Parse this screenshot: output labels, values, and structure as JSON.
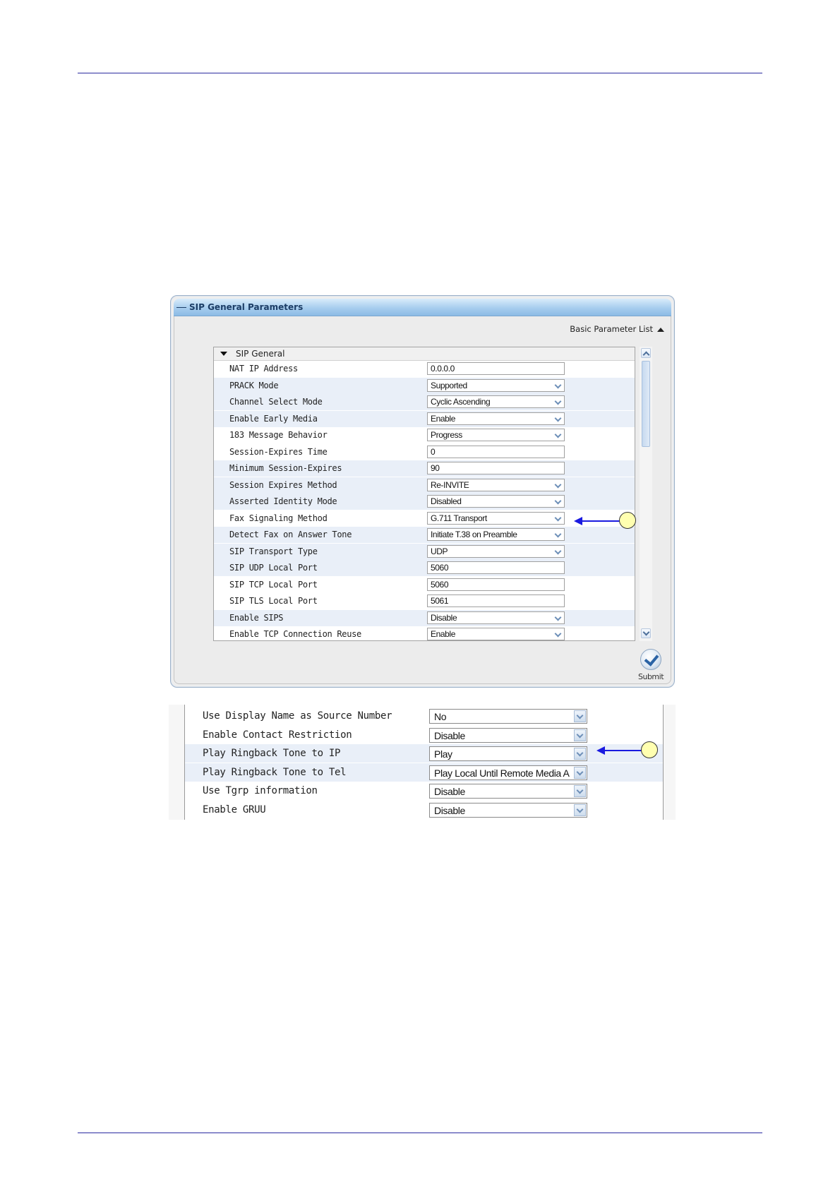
{
  "panel": {
    "title": "SIP General Parameters",
    "basic_list_label": "Basic Parameter List",
    "section_label": "SIP General",
    "submit_label": "Submit",
    "rows": [
      {
        "label": "NAT IP Address",
        "value": "0.0.0.0",
        "type": "text"
      },
      {
        "label": "PRACK Mode",
        "value": "Supported",
        "type": "select"
      },
      {
        "label": "Channel Select Mode",
        "value": "Cyclic Ascending",
        "type": "select"
      },
      {
        "label": "Enable Early Media",
        "value": "Enable",
        "type": "select"
      },
      {
        "label": "183 Message Behavior",
        "value": "Progress",
        "type": "select"
      },
      {
        "label": "Session-Expires Time",
        "value": "0",
        "type": "text"
      },
      {
        "label": "Minimum Session-Expires",
        "value": "90",
        "type": "text"
      },
      {
        "label": "Session Expires Method",
        "value": "Re-INVITE",
        "type": "select"
      },
      {
        "label": "Asserted Identity Mode",
        "value": "Disabled",
        "type": "select"
      },
      {
        "label": "Fax Signaling Method",
        "value": "G.711 Transport",
        "type": "select"
      },
      {
        "label": "Detect Fax on Answer Tone",
        "value": "Initiate T.38 on Preamble",
        "type": "select"
      },
      {
        "label": "SIP Transport Type",
        "value": "UDP",
        "type": "select"
      },
      {
        "label": "SIP UDP Local Port",
        "value": "5060",
        "type": "text"
      },
      {
        "label": "SIP TCP Local Port",
        "value": "5060",
        "type": "text"
      },
      {
        "label": "SIP TLS Local Port",
        "value": "5061",
        "type": "text"
      },
      {
        "label": "Enable SIPS",
        "value": "Disable",
        "type": "select"
      },
      {
        "label": "Enable TCP Connection Reuse",
        "value": "Enable",
        "type": "select"
      }
    ]
  },
  "lower": {
    "rows": [
      {
        "label": "Use Display Name as Source Number",
        "value": "No"
      },
      {
        "label": "Enable Contact Restriction",
        "value": "Disable"
      },
      {
        "label": "Play Ringback Tone to IP",
        "value": "Play"
      },
      {
        "label": "Play Ringback Tone to Tel",
        "value": "Play Local Until Remote Media A"
      },
      {
        "label": "Use Tgrp information",
        "value": "Disable"
      },
      {
        "label": "Enable GRUU",
        "value": "Disable"
      }
    ]
  }
}
